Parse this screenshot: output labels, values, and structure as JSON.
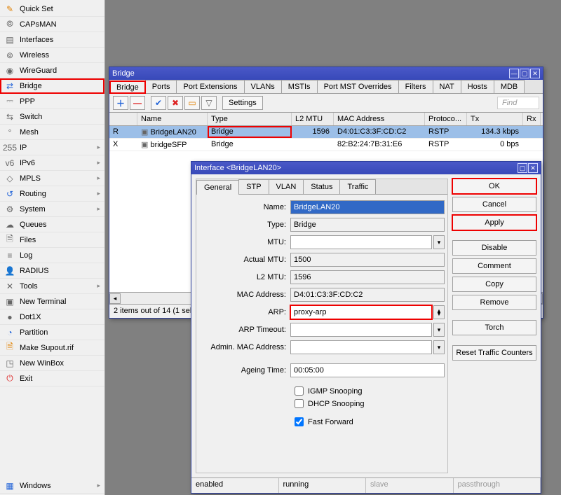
{
  "sidebar": {
    "items": [
      {
        "label": "Quick Set",
        "icon": "✎",
        "cls": "c-orange"
      },
      {
        "label": "CAPsMAN",
        "icon": "⦾",
        "cls": "c-grey"
      },
      {
        "label": "Interfaces",
        "icon": "▤",
        "cls": "c-grey"
      },
      {
        "label": "Wireless",
        "icon": "⊚",
        "cls": "c-grey"
      },
      {
        "label": "WireGuard",
        "icon": "◉",
        "cls": "c-grey"
      },
      {
        "label": "Bridge",
        "icon": "⇄",
        "cls": "c-blue",
        "highlight": true
      },
      {
        "label": "PPP",
        "icon": "⎓",
        "cls": "c-grey"
      },
      {
        "label": "Switch",
        "icon": "⇆",
        "cls": "c-grey"
      },
      {
        "label": "Mesh",
        "icon": "°",
        "cls": "c-grey"
      },
      {
        "label": "IP",
        "icon": "255",
        "cls": "c-grey",
        "sub": "▹"
      },
      {
        "label": "IPv6",
        "icon": "v6",
        "cls": "c-grey",
        "sub": "▹"
      },
      {
        "label": "MPLS",
        "icon": "◇",
        "cls": "c-grey",
        "sub": "▹"
      },
      {
        "label": "Routing",
        "icon": "↺",
        "cls": "c-blue",
        "sub": "▹"
      },
      {
        "label": "System",
        "icon": "⚙",
        "cls": "c-grey",
        "sub": "▹"
      },
      {
        "label": "Queues",
        "icon": "☁",
        "cls": "c-grey"
      },
      {
        "label": "Files",
        "icon": "🗎",
        "cls": "c-grey"
      },
      {
        "label": "Log",
        "icon": "≡",
        "cls": "c-grey"
      },
      {
        "label": "RADIUS",
        "icon": "👤",
        "cls": "c-blue"
      },
      {
        "label": "Tools",
        "icon": "✕",
        "cls": "c-grey",
        "sub": "▹"
      },
      {
        "label": "New Terminal",
        "icon": "▣",
        "cls": "c-grey"
      },
      {
        "label": "Dot1X",
        "icon": "●",
        "cls": "c-grey"
      },
      {
        "label": "Partition",
        "icon": "◔",
        "cls": "c-blue"
      },
      {
        "label": "Make Supout.rif",
        "icon": "🗎",
        "cls": "c-orange"
      },
      {
        "label": "New WinBox",
        "icon": "◳",
        "cls": "c-grey"
      },
      {
        "label": "Exit",
        "icon": "⏻",
        "cls": "c-red"
      }
    ],
    "bottom": [
      {
        "label": "Windows",
        "icon": "▦",
        "cls": "c-blue",
        "sub": "▹"
      }
    ]
  },
  "bridgeWindow": {
    "title": "Bridge",
    "tabs": [
      "Bridge",
      "Ports",
      "Port Extensions",
      "VLANs",
      "MSTIs",
      "Port MST Overrides",
      "Filters",
      "NAT",
      "Hosts",
      "MDB"
    ],
    "activeTab": "Bridge",
    "toolbar": {
      "settings": "Settings",
      "find": "Find"
    },
    "columns": [
      "",
      "Name",
      "Type",
      "L2 MTU",
      "MAC Address",
      "Protoco...",
      "Tx",
      "Rx"
    ],
    "widths": [
      40,
      100,
      120,
      60,
      130,
      60,
      80,
      25
    ],
    "rows": [
      {
        "flag": "R",
        "name": "BridgeLAN20",
        "type": "Bridge",
        "l2mtu": "1596",
        "mac": "D4:01:C3:3F:CD:C2",
        "proto": "RSTP",
        "tx": "134.3 kbps",
        "sel": true,
        "rx": ""
      },
      {
        "flag": "X",
        "name": "bridgeSFP",
        "type": "Bridge",
        "l2mtu": "",
        "mac": "82:B2:24:7B:31:E6",
        "proto": "RSTP",
        "tx": "0 bps",
        "rx": ""
      }
    ],
    "status": "2 items out of 14 (1 selected)"
  },
  "ifaceDialog": {
    "title": "Interface <BridgeLAN20>",
    "tabs": [
      "General",
      "STP",
      "VLAN",
      "Status",
      "Traffic"
    ],
    "activeTab": "General",
    "fields": {
      "name_l": "Name:",
      "name": "BridgeLAN20",
      "type_l": "Type:",
      "type": "Bridge",
      "mtu_l": "MTU:",
      "mtu": "",
      "actual_mtu_l": "Actual MTU:",
      "actual_mtu": "1500",
      "l2mtu_l": "L2 MTU:",
      "l2mtu": "1596",
      "mac_l": "MAC Address:",
      "mac": "D4:01:C3:3F:CD:C2",
      "arp_l": "ARP:",
      "arp": "proxy-arp",
      "arp_timeout_l": "ARP Timeout:",
      "arp_timeout": "",
      "admin_mac_l": "Admin. MAC Address:",
      "admin_mac": "",
      "ageing_l": "Ageing Time:",
      "ageing": "00:05:00",
      "igmp": "IGMP Snooping",
      "dhcp": "DHCP Snooping",
      "ff": "Fast Forward"
    },
    "buttons": {
      "ok": "OK",
      "cancel": "Cancel",
      "apply": "Apply",
      "disable": "Disable",
      "comment": "Comment",
      "copy": "Copy",
      "remove": "Remove",
      "torch": "Torch",
      "reset": "Reset Traffic Counters"
    },
    "status": [
      "enabled",
      "running",
      "slave",
      "passthrough"
    ]
  }
}
